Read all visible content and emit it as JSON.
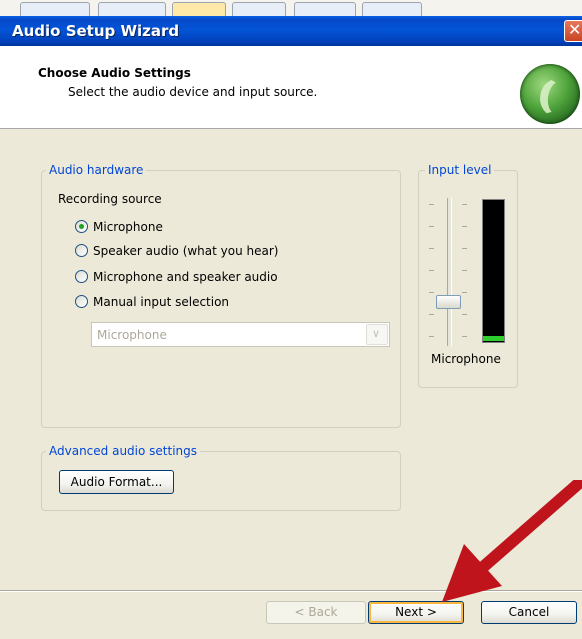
{
  "window": {
    "title": "Audio Setup Wizard",
    "close_glyph": "✕"
  },
  "header": {
    "title": "Choose Audio Settings",
    "subtitle": "Select the audio device and input source.",
    "logo_icon": "wizard-logo-icon"
  },
  "audio_hardware": {
    "legend": "Audio hardware",
    "recording_source_label": "Recording source",
    "options": [
      {
        "label": "Microphone",
        "selected": true
      },
      {
        "label": "Speaker audio (what you hear)",
        "selected": false
      },
      {
        "label": "Microphone and speaker audio",
        "selected": false
      },
      {
        "label": "Manual input selection",
        "selected": false
      }
    ],
    "device_select": {
      "value": "Microphone",
      "enabled": false
    }
  },
  "input_level": {
    "legend": "Input level",
    "device_label": "Microphone",
    "meter_level_fraction": 0.03
  },
  "advanced": {
    "legend": "Advanced audio settings",
    "audio_format_button": "Audio Format..."
  },
  "footer": {
    "back_button": "< Back",
    "next_button": "Next >",
    "cancel_button": "Cancel"
  },
  "colors": {
    "title_bar": "#0454d8",
    "legend_text": "#0046d5",
    "meter_fill": "#2ece2e",
    "annotation_arrow": "#c0141c"
  }
}
